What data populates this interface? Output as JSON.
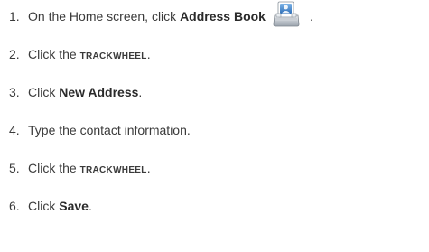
{
  "steps": [
    {
      "number": "1.",
      "parts": [
        {
          "text": "On the Home screen, click ",
          "style": "plain"
        },
        {
          "text": "Address Book",
          "style": "bold"
        }
      ],
      "icon": "address-book-icon",
      "trailing": "."
    },
    {
      "number": "2.",
      "parts": [
        {
          "text": "Click the ",
          "style": "plain"
        },
        {
          "text": "TRACKWHEEL",
          "style": "smallcaps"
        },
        {
          "text": ".",
          "style": "plain"
        }
      ]
    },
    {
      "number": "3.",
      "parts": [
        {
          "text": "Click ",
          "style": "plain"
        },
        {
          "text": "New Address",
          "style": "bold"
        },
        {
          "text": ".",
          "style": "plain"
        }
      ]
    },
    {
      "number": "4.",
      "parts": [
        {
          "text": "Type the contact information.",
          "style": "plain"
        }
      ]
    },
    {
      "number": "5.",
      "parts": [
        {
          "text": "Click the ",
          "style": "plain"
        },
        {
          "text": "TRACKWHEEL",
          "style": "smallcaps"
        },
        {
          "text": ".",
          "style": "plain"
        }
      ]
    },
    {
      "number": "6.",
      "parts": [
        {
          "text": "Click ",
          "style": "plain"
        },
        {
          "text": "Save",
          "style": "bold"
        },
        {
          "text": ".",
          "style": "plain"
        }
      ]
    }
  ]
}
